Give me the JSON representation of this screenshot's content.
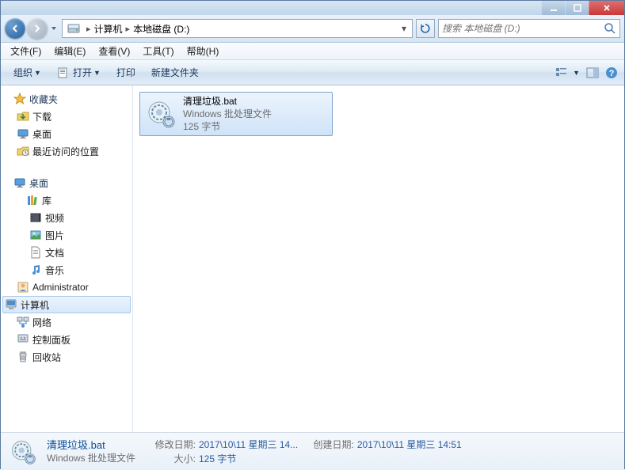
{
  "address": {
    "segments": [
      "计算机",
      "本地磁盘 (D:)"
    ]
  },
  "search": {
    "placeholder": "搜索 本地磁盘 (D:)"
  },
  "menu": {
    "file": "文件(F)",
    "edit": "编辑(E)",
    "view": "查看(V)",
    "tools": "工具(T)",
    "help": "帮助(H)"
  },
  "toolbar": {
    "organize": "组织",
    "open": "打开",
    "print": "打印",
    "newfolder": "新建文件夹"
  },
  "sidebar": {
    "favorites": {
      "label": "收藏夹",
      "items": [
        {
          "label": "下载",
          "icon": "download"
        },
        {
          "label": "桌面",
          "icon": "desktop"
        },
        {
          "label": "最近访问的位置",
          "icon": "recent"
        }
      ]
    },
    "desktop": {
      "label": "桌面",
      "items": [
        {
          "label": "库",
          "icon": "library",
          "expanded": true,
          "children": [
            {
              "label": "视频",
              "icon": "video"
            },
            {
              "label": "图片",
              "icon": "picture"
            },
            {
              "label": "文档",
              "icon": "document"
            },
            {
              "label": "音乐",
              "icon": "music"
            }
          ]
        },
        {
          "label": "Administrator",
          "icon": "user"
        },
        {
          "label": "计算机",
          "icon": "computer",
          "selected": true
        },
        {
          "label": "网络",
          "icon": "network"
        },
        {
          "label": "控制面板",
          "icon": "control"
        },
        {
          "label": "回收站",
          "icon": "recycle"
        }
      ]
    }
  },
  "file": {
    "name": "清理垃圾.bat",
    "type": "Windows 批处理文件",
    "size": "125 字节"
  },
  "details": {
    "name": "清理垃圾.bat",
    "type": "Windows 批处理文件",
    "mod_label": "修改日期:",
    "mod_val": "2017\\10\\11 星期三 14...",
    "created_label": "创建日期:",
    "created_val": "2017\\10\\11 星期三 14:51",
    "size_label": "大小:",
    "size_val": "125 字节"
  }
}
